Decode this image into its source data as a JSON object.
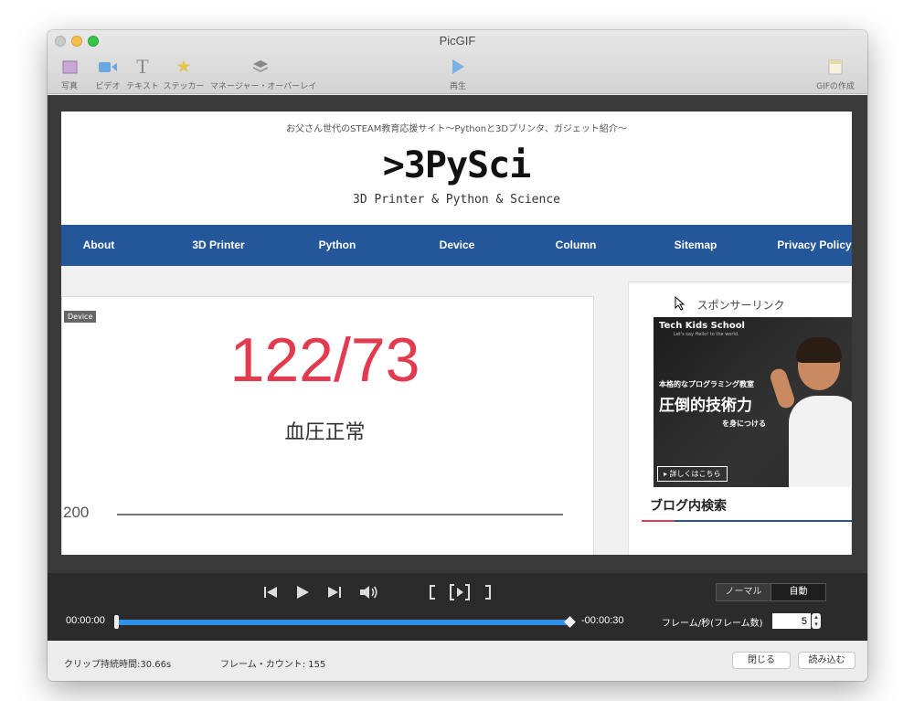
{
  "window": {
    "title": "PicGIF"
  },
  "toolbar": {
    "items": [
      {
        "label": "写真",
        "icon": "photo-icon"
      },
      {
        "label": "ビデオ",
        "icon": "video-camera-icon"
      },
      {
        "label": "テキスト",
        "icon": "text-icon"
      },
      {
        "label": "ステッカー",
        "icon": "star-icon"
      },
      {
        "label": "マネージャー・オーバーレイ",
        "icon": "layers-icon"
      },
      {
        "label": "再生",
        "icon": "play-icon"
      },
      {
        "label": "GIFの作成",
        "icon": "gif-create-icon"
      }
    ]
  },
  "preview": {
    "tagline": "お父さん世代のSTEAM教育応援サイト〜Pythonと3Dプリンタ、ガジェット紹介〜",
    "logo": ">3PySci",
    "logo_sub": "3D Printer & Python & Science",
    "nav": [
      "About",
      "3D Printer",
      "Python",
      "Device",
      "Column",
      "Sitemap",
      "Privacy Policy"
    ],
    "badge": "Device",
    "bp_value": "122/73",
    "bp_label": "血圧正常",
    "axis_value": "200",
    "sponsor": "スポンサーリンク",
    "ad": {
      "brand": "Tech Kids School",
      "tagline": "Let's say Hello! to the world.",
      "line1": "本格的なプログラミング教室",
      "line2": "圧倒的技術力",
      "line3": "を身につける",
      "button": "▸ 詳しくはこちら"
    },
    "blog_search": "ブログ内検索",
    "accent_color": "#23579a",
    "highlight_color": "#e23b4f"
  },
  "controls": {
    "mode_normal": "ノーマル",
    "mode_auto": "自動",
    "active_mode": "自動",
    "time_start": "00:00:00",
    "time_remaining": "-00:00:30",
    "fps_label": "フレーム/秒(フレーム数)",
    "fps_value": "5",
    "progress": 1.0
  },
  "status": {
    "clip_duration": "クリップ持続時間:30.66s",
    "frame_count": "フレーム・カウント: 155",
    "close_button": "閉じる",
    "import_button": "読み込む"
  }
}
